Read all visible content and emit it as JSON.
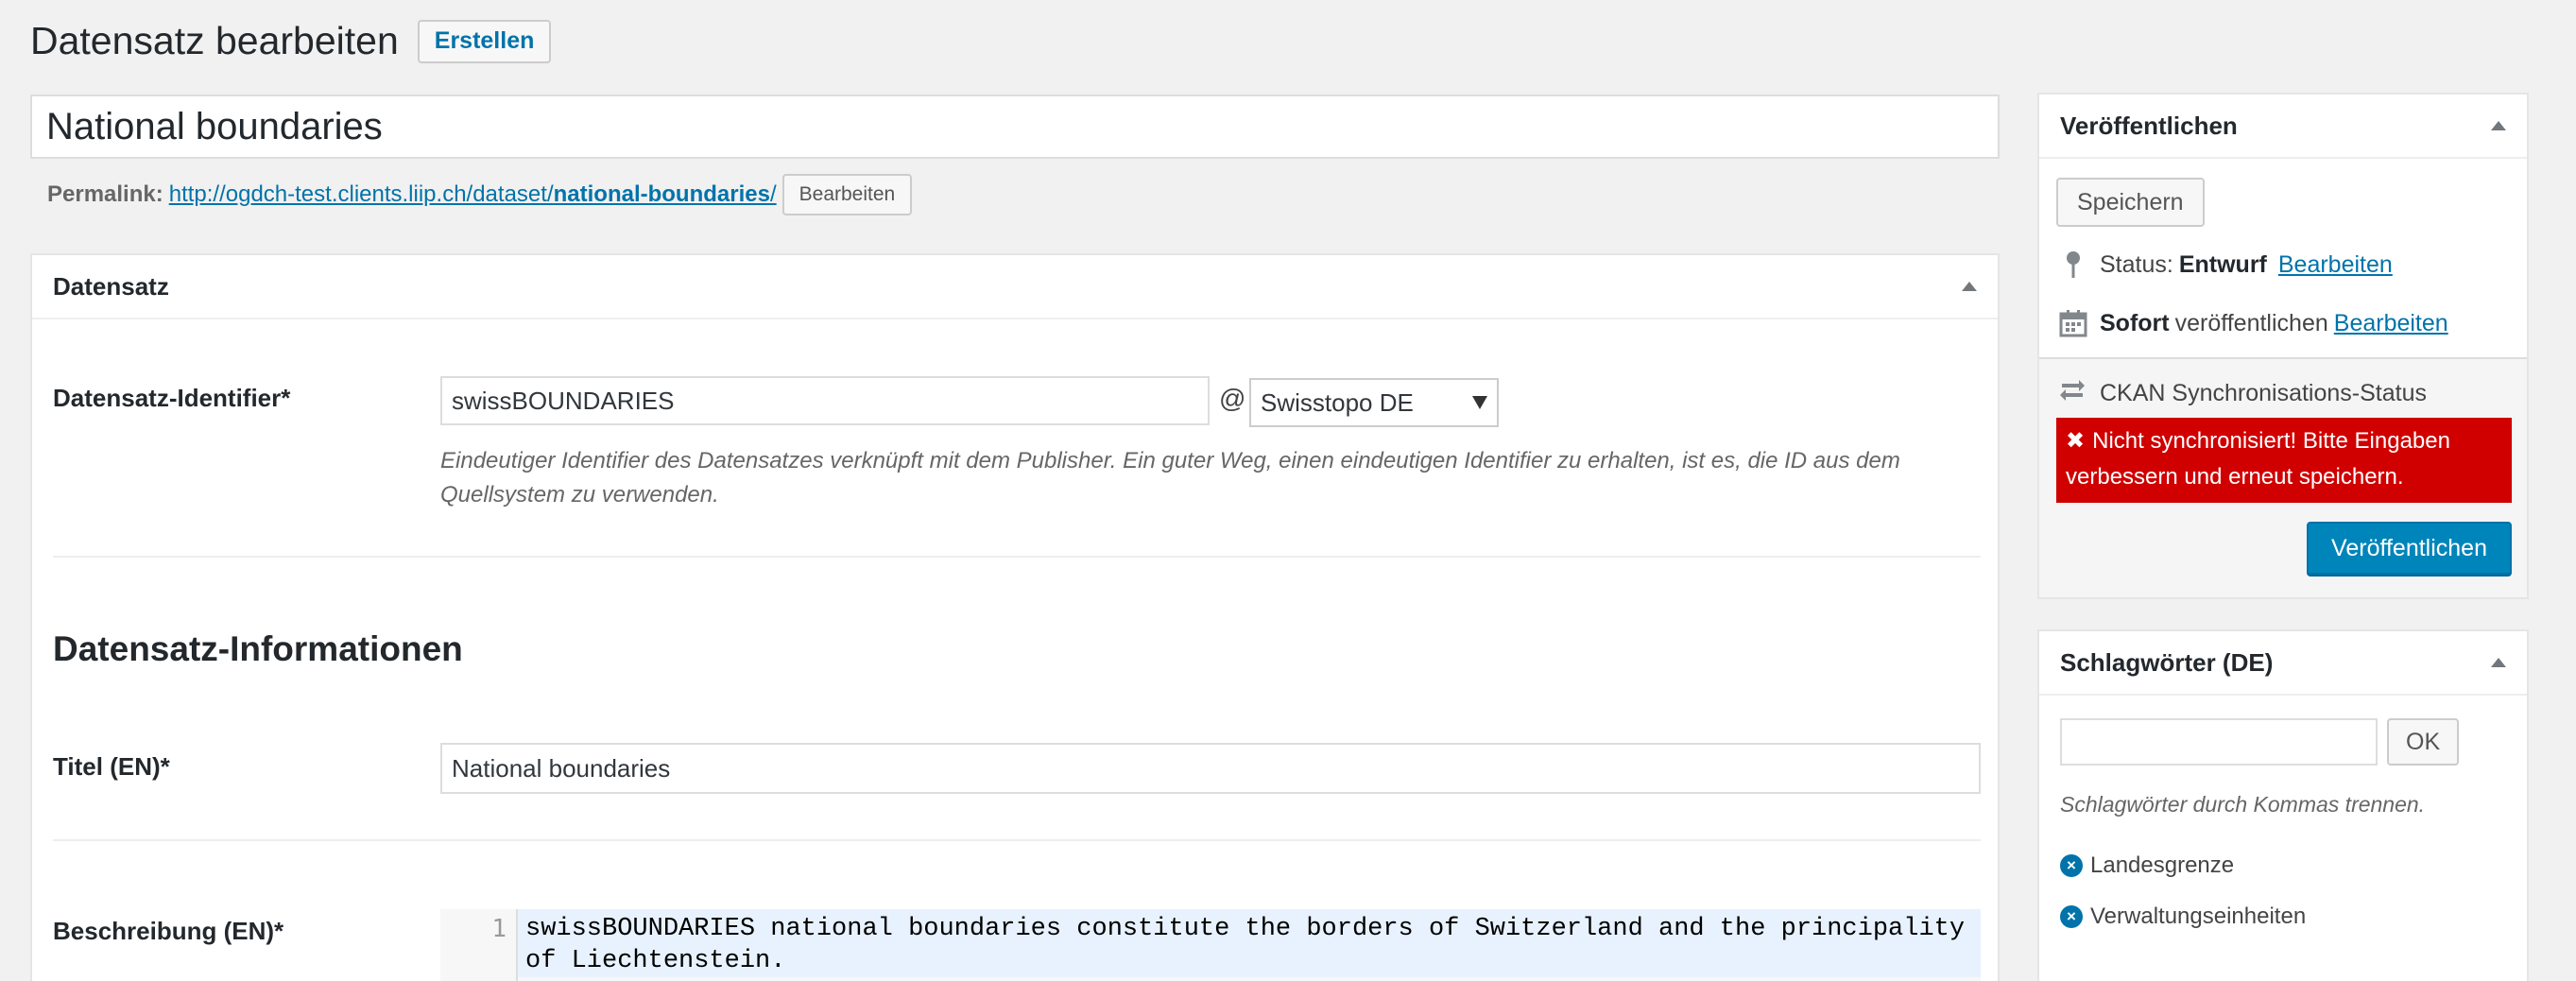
{
  "header": {
    "title": "Datensatz bearbeiten",
    "create_label": "Erstellen"
  },
  "post": {
    "title_value": "National boundaries",
    "permalink_label": "Permalink:",
    "permalink_base": "http://ogdch-test.clients.liip.ch/dataset/",
    "permalink_slug": "national-boundaries",
    "permalink_trailing": "/",
    "permalink_edit_label": "Bearbeiten"
  },
  "dataset_box": {
    "title": "Datensatz",
    "identifier_label": "Datensatz-Identifier*",
    "identifier_value": "swissBOUNDARIES",
    "at_sign": "@",
    "publisher_selected": "Swisstopo DE",
    "identifier_help_line1": "Eindeutiger Identifier des Datensatzes verknüpft mit dem Publisher. Ein guter Weg, einen eindeutigen Identifier zu erhalten, ist es, die ID aus dem",
    "identifier_help_line2": "Quellsystem zu verwenden.",
    "info_heading": "Datensatz-Informationen",
    "title_en_label": "Titel (EN)*",
    "title_en_value": "National boundaries",
    "desc_en_label": "Beschreibung (EN)*",
    "desc_line_number": "1",
    "desc_line1": "swissBOUNDARIES national boundaries constitute the borders of Switzerland and the principality",
    "desc_line2": "of Liechtenstein."
  },
  "publish_box": {
    "title": "Veröffentlichen",
    "save_label": "Speichern",
    "status_label": "Status:",
    "status_value": "Entwurf",
    "status_edit": "Bearbeiten",
    "schedule_value": "Sofort",
    "schedule_text": "veröffentlichen",
    "schedule_edit": "Bearbeiten",
    "sync_title": "CKAN Synchronisations-Status",
    "sync_error": "Nicht synchronisiert! Bitte Eingaben verbessern und erneut speichern.",
    "publish_label": "Veröffentlichen"
  },
  "tags_box": {
    "title": "Schlagwörter (DE)",
    "ok_label": "OK",
    "hint": "Schlagwörter durch Kommas trennen.",
    "tags": [
      "Landesgrenze",
      "Verwaltungseinheiten"
    ]
  },
  "colors": {
    "accent": "#0073aa",
    "primary_button": "#0085ba",
    "error": "#d00000"
  }
}
